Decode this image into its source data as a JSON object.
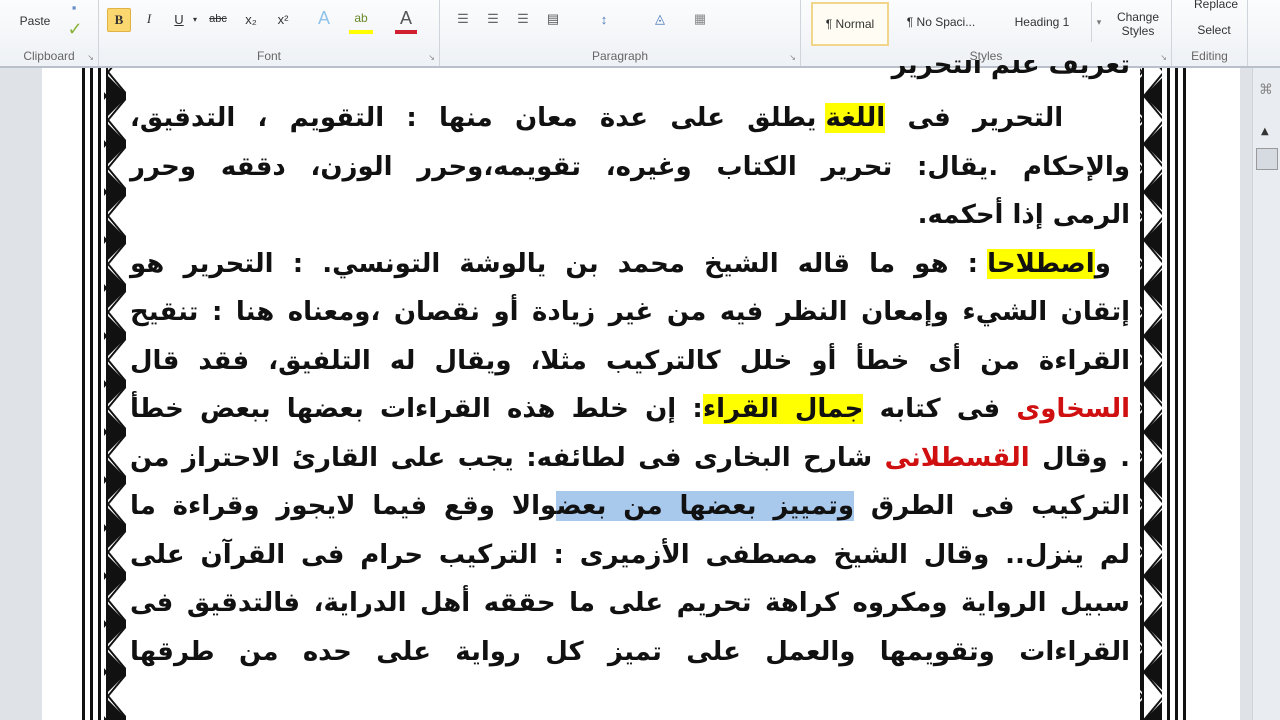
{
  "ribbon": {
    "clipboard": {
      "paste": "Paste",
      "label": "Clipboard"
    },
    "font": {
      "label": "Font",
      "bold": "B",
      "italic": "I",
      "underline": "U",
      "strike": "abc",
      "subscript": "x₂",
      "superscript": "x²",
      "text_effects": "A",
      "highlight": "ab",
      "font_color": "A"
    },
    "paragraph": {
      "label": "Paragraph"
    },
    "styles": {
      "label": "Styles",
      "items": [
        "¶ Normal",
        "¶ No Spaci...",
        "Heading 1"
      ],
      "change_styles": "Change Styles"
    },
    "editing": {
      "label": "Editing",
      "replace": "Replace",
      "select": "Select"
    }
  },
  "document": {
    "title_line": "تعريف علم التحرير",
    "l1": {
      "a": "التحرير فى ",
      "hl": "اللغة",
      "b": " يطلق على عدة معان منها : التقويم ، التدقيق،"
    },
    "l2": "والإحكام .يقال: تحرير الكتاب وغيره، تقويمه،وحرر الوزن، دققه وحرر",
    "l3": "الرمى إذا أحكمه.",
    "l4": {
      "a": "و",
      "hl": "اصطلاحا",
      "b": " : هو ما قاله الشيخ محمد بن يالوشة التونسي. : التحرير هو"
    },
    "l5": "إتقان الشيء وإمعان النظر فيه من غير زيادة أو نقصان ،ومعناه هنا : تنقيح",
    "l6": "القراءة من أى خطأ أو خلل كالتركيب مثلا، ويقال له التلفيق، فقد قال",
    "l7": {
      "red": "السخاوى",
      "a": " فى كتابه ",
      "hl": "جمال القراء",
      "b": ": إن خلط هذه القراءات بعضها ببعض خطأ"
    },
    "l8": {
      "a": ". وقال ",
      "red": "القسطلانى",
      "b": " شارح البخارى فى لطائفه: يجب على القارئ الاحتراز من"
    },
    "l9": {
      "a": "التركيب فى الطرق ",
      "sel": "وتمييز بعضها من بعض",
      "b": "والا وقع فيما لايجوز وقراءة ما"
    },
    "l10": "لم ينزل.. وقال الشيخ مصطفى الأزميرى : التركيب حرام فى القرآن على",
    "l11": "سبيل الرواية ومكروه كراهة تحريم على ما حققه أهل الدراية، فالتدقيق فى",
    "l12": "القراءات وتقويمها والعمل على تميز كل رواية على حده من طرقها"
  },
  "colors": {
    "highlight": "#ffff00",
    "selection": "#a9c9ec",
    "name_red": "#d01010"
  }
}
